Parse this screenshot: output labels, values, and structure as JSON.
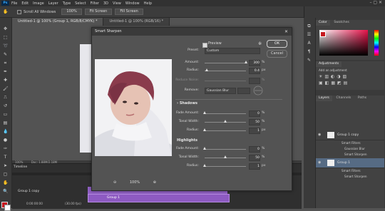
{
  "app": {
    "logo": "Ps",
    "menu": [
      "File",
      "Edit",
      "Image",
      "Layer",
      "Type",
      "Select",
      "Filter",
      "3D",
      "View",
      "Window",
      "Help"
    ]
  },
  "options_bar": {
    "scroll_all": "Scroll All Windows",
    "zoom": "100%",
    "fit_screen": "Fit Screen",
    "fill_screen": "Fill Screen"
  },
  "doc_tabs": [
    "Untitled-1 @ 100% (Group 1, RGB/8/CMYK) *",
    "Untitled-1 @ 100% (RGB/16) *"
  ],
  "status": {
    "zoom": "100%",
    "doc": "Doc: 1.88M/2.18M"
  },
  "timeline": {
    "title": "Timeline",
    "group_label": "Group 1 copy",
    "track_label": "Group 1",
    "timecode": "0:00:00:00",
    "fps": "(30.00 fps)"
  },
  "colors": {
    "fg": "#c7181f",
    "accent": "#8d5ac2",
    "selected_layer": "#566b84"
  },
  "right_panel": {
    "color_tabs": [
      "Color",
      "Swatches"
    ],
    "adjust_tabs": [
      "Adjustments"
    ],
    "adjust_hint": "Add an adjustment",
    "layers_tabs": [
      "Layers",
      "Channels",
      "Paths"
    ],
    "layers": [
      {
        "name": "Group 1 copy",
        "selected": false
      },
      {
        "name": "Smart Filters",
        "sub": true
      },
      {
        "name": "Gaussian Blur",
        "sub": true
      },
      {
        "name": "Smart Sharpen",
        "sub": true
      },
      {
        "name": "Group 1",
        "selected": true
      },
      {
        "name": "Smart Filters",
        "sub": true
      },
      {
        "name": "Smart Sharpen",
        "sub": true
      }
    ]
  },
  "dialog": {
    "title": "Smart Sharpen",
    "ok": "OK",
    "cancel": "Cancel",
    "preview_label": "Preview",
    "preset_label": "Preset:",
    "preset_value": "Custom",
    "amount_label": "Amount:",
    "amount_value": "300",
    "amount_unit": "%",
    "radius_label": "Radius:",
    "radius_value": "0.4",
    "radius_unit": "px",
    "reduce_noise_label": "Reduce Noise:",
    "reduce_noise_unit": "%",
    "remove_label": "Remove:",
    "remove_value": "Gaussian Blur",
    "shadows_title": "Shadows",
    "highlights_title": "Highlights",
    "fade_label": "Fade Amount:",
    "tonal_label": "Tonal Width:",
    "radius2_label": "Radius:",
    "shadows": {
      "fade": "0",
      "tonal": "50",
      "radius": "1"
    },
    "highlights": {
      "fade": "0",
      "tonal": "50",
      "radius": "1"
    },
    "pct": "%",
    "px": "px",
    "zoom_value": "100%",
    "zoom_out": "⊖",
    "zoom_in": "⊕"
  }
}
